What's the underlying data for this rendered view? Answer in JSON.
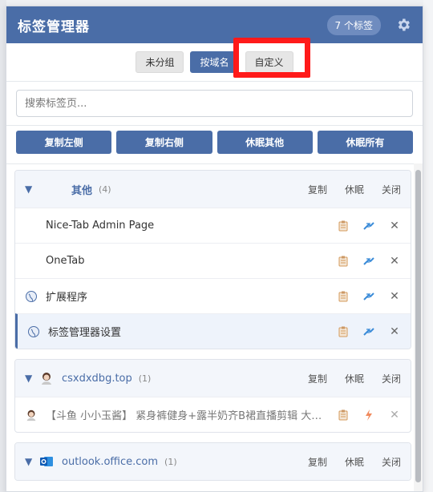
{
  "header": {
    "title": "标签管理器",
    "tab_count": "7 个标签"
  },
  "grouping": {
    "options": [
      "未分组",
      "按域名",
      "自定义"
    ],
    "active": "按域名"
  },
  "search": {
    "placeholder": "搜索标签页..."
  },
  "actions": [
    "复制左侧",
    "复制右侧",
    "休眠其他",
    "休眠所有"
  ],
  "groups": [
    {
      "name": "其他",
      "count": "(4)",
      "actions": [
        "复制",
        "休眠",
        "关闭"
      ],
      "tabs": [
        {
          "title": "Nice-Tab Admin Page",
          "icon": "none"
        },
        {
          "title": "OneTab",
          "icon": "none"
        },
        {
          "title": "扩展程序",
          "icon": "globe-icon"
        },
        {
          "title": "标签管理器设置",
          "icon": "globe-icon",
          "active": true
        }
      ]
    },
    {
      "name": "csxdxdbg.top",
      "count": "(1)",
      "actions": [
        "复制",
        "休眠",
        "关闭"
      ],
      "tabs": [
        {
          "title": "【斗鱼 小小玉酱】 紧身裤健身+露半奶齐B裙直播剪辑 大摆...",
          "icon": "avatar-icon",
          "dim": true
        }
      ]
    },
    {
      "name": "outlook.office.com",
      "count": "(1)",
      "actions": [
        "复制",
        "休眠",
        "关闭"
      ]
    }
  ],
  "colors": {
    "primary": "#4a6da7",
    "highlight": "#ff1a1a"
  }
}
